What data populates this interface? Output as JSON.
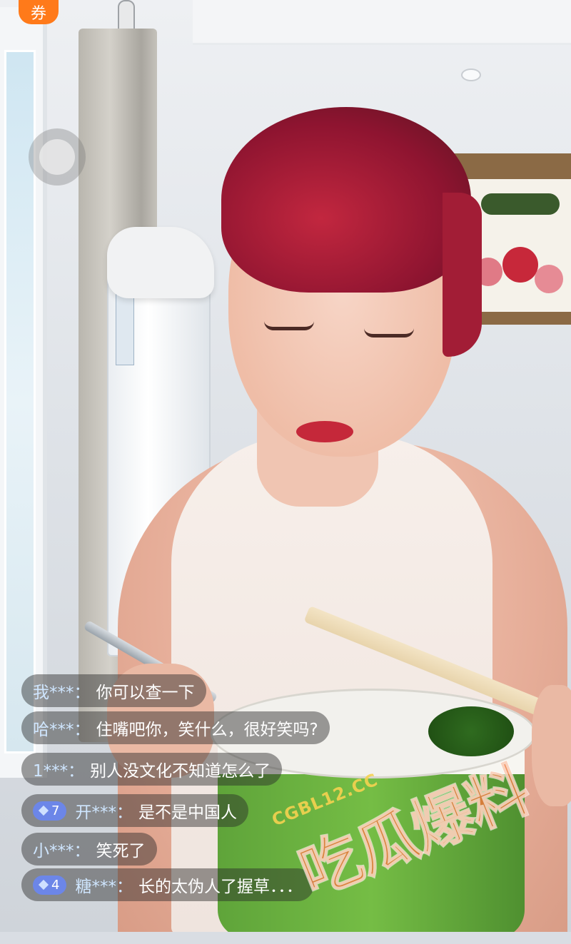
{
  "overlay": {
    "coupon_badge": "券",
    "float_ball_icon": "floating-ball-icon"
  },
  "chat": {
    "messages": [
      {
        "user": "我***：",
        "text": "你可以查一下",
        "level": null
      },
      {
        "user": "哈***：",
        "text": "住嘴吧你，笑什么，很好笑吗?",
        "level": null
      },
      {
        "user": "1***：",
        "text": "别人没文化不知道怎么了",
        "level": null
      },
      {
        "user": "开***：",
        "text": "是不是中国人",
        "level": "7"
      },
      {
        "user": "小***：",
        "text": "笑死了",
        "level": null
      },
      {
        "user": "糖***：",
        "text": "长的太伪人了握草．．．",
        "level": "4"
      }
    ]
  },
  "watermark": {
    "site": "CGBL12.CC",
    "name": "吃瓜爆料"
  },
  "colors": {
    "coupon": "#ff7a1a",
    "level_badge": "#6c86e8",
    "chat_bg": "rgba(40,40,40,.45)"
  }
}
